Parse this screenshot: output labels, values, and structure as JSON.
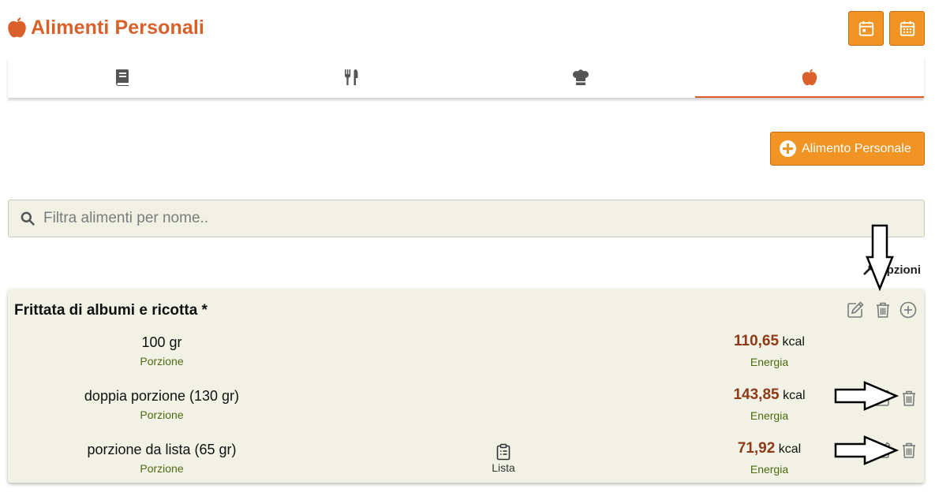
{
  "header": {
    "title": "Alimenti Personali",
    "title_icon": "apple-icon",
    "buttons": [
      {
        "icon": "calendar-day-icon"
      },
      {
        "icon": "calendar-week-icon"
      }
    ]
  },
  "tabs": [
    {
      "icon": "book-icon",
      "active": false
    },
    {
      "icon": "utensils-icon",
      "active": false
    },
    {
      "icon": "chef-hat-icon",
      "active": false
    },
    {
      "icon": "apple-icon",
      "active": true
    }
  ],
  "add_button": {
    "label": "Alimento Personale",
    "icon": "plus-circle-icon"
  },
  "search": {
    "placeholder": "Filtra alimenti per nome..",
    "value": ""
  },
  "options": {
    "label": "Opzioni",
    "icon": "wrench-icon"
  },
  "food_card": {
    "title": "Frittata di albumi e ricotta *",
    "actions": [
      "edit-icon",
      "trash-icon",
      "plus-circle-icon"
    ],
    "portions": [
      {
        "name": "100 gr",
        "name_caption": "Porzione",
        "energy_value": "110,65",
        "energy_unit": "kcal",
        "energy_caption": "Energia",
        "has_list": false,
        "actions": []
      },
      {
        "name": "doppia porzione (130 gr)",
        "name_caption": "Porzione",
        "energy_value": "143,85",
        "energy_unit": "kcal",
        "energy_caption": "Energia",
        "has_list": false,
        "actions": [
          "edit-icon",
          "trash-icon"
        ]
      },
      {
        "name": "porzione da lista (65 gr)",
        "name_caption": "Porzione",
        "energy_value": "71,92",
        "energy_unit": "kcal",
        "energy_caption": "Energia",
        "has_list": true,
        "list_label": "Lista",
        "actions": [
          "edit-icon",
          "trash-icon"
        ]
      }
    ]
  },
  "colors": {
    "accent": "#f29423",
    "title": "#d9602a",
    "energy_value": "#8e3a17",
    "caption": "#4e6a10",
    "card_bg": "#f1f1e5",
    "icon_gray": "#7a7a7a"
  }
}
